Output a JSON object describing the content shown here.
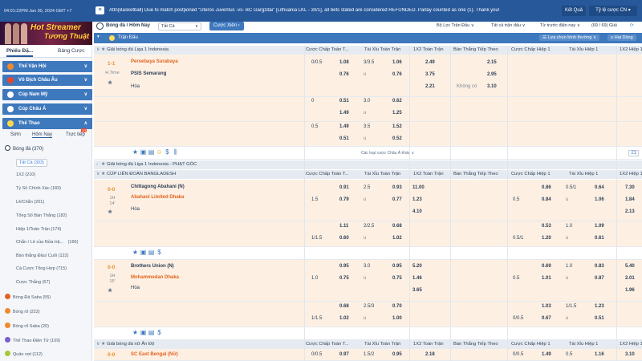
{
  "topbar": {
    "clock": "04:01:22PM Jan 30, 2024 GMT +7",
    "announcement": "Attn(Basketball) Due to match postponed \"Uteros Juventus -vs- BC Gargzdai\" [Lithuania LKL - 30/1], all bets stated are considered REFUNDED. Parlay counted as one (1). Thank you!",
    "result_btn": "Kết Quả",
    "odds_btn": "Tỷ lệ cược CN ▾"
  },
  "banner": {
    "line1": "Hot Streamer",
    "line2": "Tương Thuật"
  },
  "sidebar": {
    "tabs": [
      "Phiếu Đặ...",
      "Bảng Cược"
    ],
    "cats": [
      {
        "label": "Thể Vận Hội",
        "arrow": "∨"
      },
      {
        "label": "Vô Địch Châu Âu",
        "arrow": "∨"
      },
      {
        "label": "Cúp Nam Mỹ",
        "arrow": "∨"
      },
      {
        "label": "Cúp Châu Á",
        "arrow": "∨"
      },
      {
        "label": "Thể Thao",
        "arrow": "∧"
      }
    ],
    "time_tabs": [
      "Sớm",
      "Hôm Nay",
      "Trực tiếp"
    ],
    "live_badge": "14",
    "sport": {
      "label": "Bóng đá",
      "count": "(370)"
    },
    "items": [
      {
        "label": "Tất Cả",
        "count": "(303)"
      },
      {
        "label": "1X2",
        "count": "(210)"
      },
      {
        "label": "Tỷ Số Chính Xác",
        "count": "(183)"
      },
      {
        "label": "Lẻ/Chẵn",
        "count": "(201)"
      },
      {
        "label": "Tổng Số Bàn Thắng",
        "count": "(182)"
      },
      {
        "label": "Hiệp 1/Toàn Trận",
        "count": "(174)"
      },
      {
        "label": "Chẵn / Lẻ của Nửa trậ...",
        "count": "(166)"
      },
      {
        "label": "Bàn thắng Đầu/ Cuối",
        "count": "(122)"
      },
      {
        "label": "Cá Cược Tổng Hợp",
        "count": "(715)"
      },
      {
        "label": "Cược Thắng",
        "count": "(67)"
      }
    ],
    "sports": [
      {
        "label": "Bóng Đá Saba",
        "count": "(55)",
        "color": "#e2631f"
      },
      {
        "label": "Bóng rổ",
        "count": "(222)",
        "color": "#f08a2a"
      },
      {
        "label": "Bóng rổ Saba",
        "count": "(20)",
        "color": "#f08a2a"
      },
      {
        "label": "Thể Thao Điện Tử",
        "count": "(109)",
        "color": "#7a5fc8"
      },
      {
        "label": "Quần vợt",
        "count": "(112)",
        "color": "#a8c83a"
      },
      {
        "label": "Cầu lông",
        "count": "(47)",
        "color": "#5aa8d8"
      }
    ]
  },
  "header": {
    "title": "Bóng đá / Hôm Nay",
    "filter": "Tất Cả",
    "parlay": "Cược Xiên",
    "league_filter": "Bộ Lọc Trận Đấu",
    "sort_all": "Tất cả trận đấu",
    "sort_time": "Từ trước điện nay",
    "counter": "(69 / 69) Giải"
  },
  "subbar": {
    "title": "Trận Đấu",
    "odds_view": "Lựa chọn bình thường",
    "compare": "Hai Dòng"
  },
  "col_heads": [
    "Cược Chấp Toàn T...",
    "Tài Xỉu Toàn Trận",
    "1X2 Toàn Trận",
    "Bàn Thắng Tiếp Theo",
    "Cược Chấp Hiệp 1",
    "Tài Xỉu Hiệp 1",
    "1X2 Hiệp 1"
  ],
  "leagues": [
    "Giải bóng đá Liga 1 Indonesia",
    "Giải bóng đá Liga 1 Indonesia - PHẠT GÓC",
    "CÚP LIÊN ĐOÀN BANGLADESH",
    "Giải bóng đá nữ Ấn Độ"
  ],
  "m1": {
    "score": "1-1",
    "time": "H.Time",
    "home": "Persebaya Surabaya",
    "away": "PSIS Semarang",
    "draw": "Hòa",
    "lines": [
      {
        "hdp": "0/0.5",
        "h1": "1.08",
        "h2": "0.76",
        "ou": "3/3.5",
        "o1": "1.06",
        "o2": "0.76",
        "x1": "2.49",
        "x2": "3.75",
        "x3": "2.21",
        "n1": "2.15",
        "n2": "2.95",
        "n3": "3.10",
        "nl": "Không có"
      },
      {
        "hdp": "0",
        "h1": "0.51",
        "h2": "1.49",
        "ou": "3.0",
        "o1": "0.62",
        "o2": "1.25"
      },
      {
        "hdp": "0.5",
        "h1": "1.49",
        "h2": "0.51",
        "ou": "3.5",
        "o1": "1.52",
        "o2": "0.52"
      }
    ],
    "under": "u",
    "more": "Các loại cược Châu Á khác ∨",
    "page": "21"
  },
  "m2": {
    "score": "0-0",
    "time1": "1H",
    "time2": "14'",
    "home": "Chittagong Abahani (N)",
    "away": "Abahani Limited Dhaka",
    "draw": "Hòa",
    "r1": {
      "h": "0.91",
      "ou": "2.5",
      "o": "0.93",
      "x": "11.00",
      "hh": "0.86",
      "hou": "0.5/1",
      "ho": "0.64",
      "hx": "7.30"
    },
    "r2": {
      "hdp": "1.5",
      "h": "0.79",
      "o": "0.77",
      "x": "1.23",
      "hhdp": "0.5",
      "hh": "0.84",
      "ho": "1.06",
      "hx": "1.84"
    },
    "r3": {
      "x": "4.10",
      "hx": "2.13"
    },
    "r4": {
      "h": "1.11",
      "ou": "2/2.5",
      "o": "0.68",
      "hh": "0.53",
      "hou": "1.0",
      "ho": "1.09"
    },
    "r5": {
      "hdp": "1/1.5",
      "h": "0.60",
      "o": "1.02",
      "hhdp": "0.5/1",
      "hh": "1.20",
      "ho": "0.61"
    }
  },
  "m3": {
    "score": "0-0",
    "time1": "1H",
    "time2": "15'",
    "home": "Brothers Union (N)",
    "away": "Mohammedan Dhaka",
    "draw": "Hòa",
    "r1": {
      "h": "0.95",
      "ou": "3.0",
      "o": "0.95",
      "x": "5.20",
      "hh": "0.69",
      "hou": "1.0",
      "ho": "0.83",
      "hx": "5.40"
    },
    "r2": {
      "hdp": "1.0",
      "h": "0.75",
      "o": "0.75",
      "x": "1.46",
      "hhdp": "0.5",
      "hh": "1.01",
      "ho": "0.87",
      "hx": "2.01"
    },
    "r3": {
      "x": "3.65",
      "hx": "1.96"
    },
    "r4": {
      "h": "0.68",
      "ou": "2.5/3",
      "o": "0.70",
      "hh": "1.03",
      "hou": "1/1.5",
      "ho": "1.23"
    },
    "r5": {
      "hdp": "1/1.5",
      "h": "1.02",
      "o": "1.00",
      "hhdp": "0/0.5",
      "hh": "0.67",
      "ho": "0.51"
    }
  },
  "m4": {
    "score": "0-0",
    "home": "SC East Bengal (Nữ)",
    "r1": {
      "hdp": "0/0.5",
      "h": "0.97",
      "ou": "1.5/2",
      "o": "0.95",
      "x": "2.18",
      "hhdp": "0/0.5",
      "hh": "1.49",
      "hou": "0.5",
      "ho": "1.16",
      "hx": "3.10"
    }
  }
}
